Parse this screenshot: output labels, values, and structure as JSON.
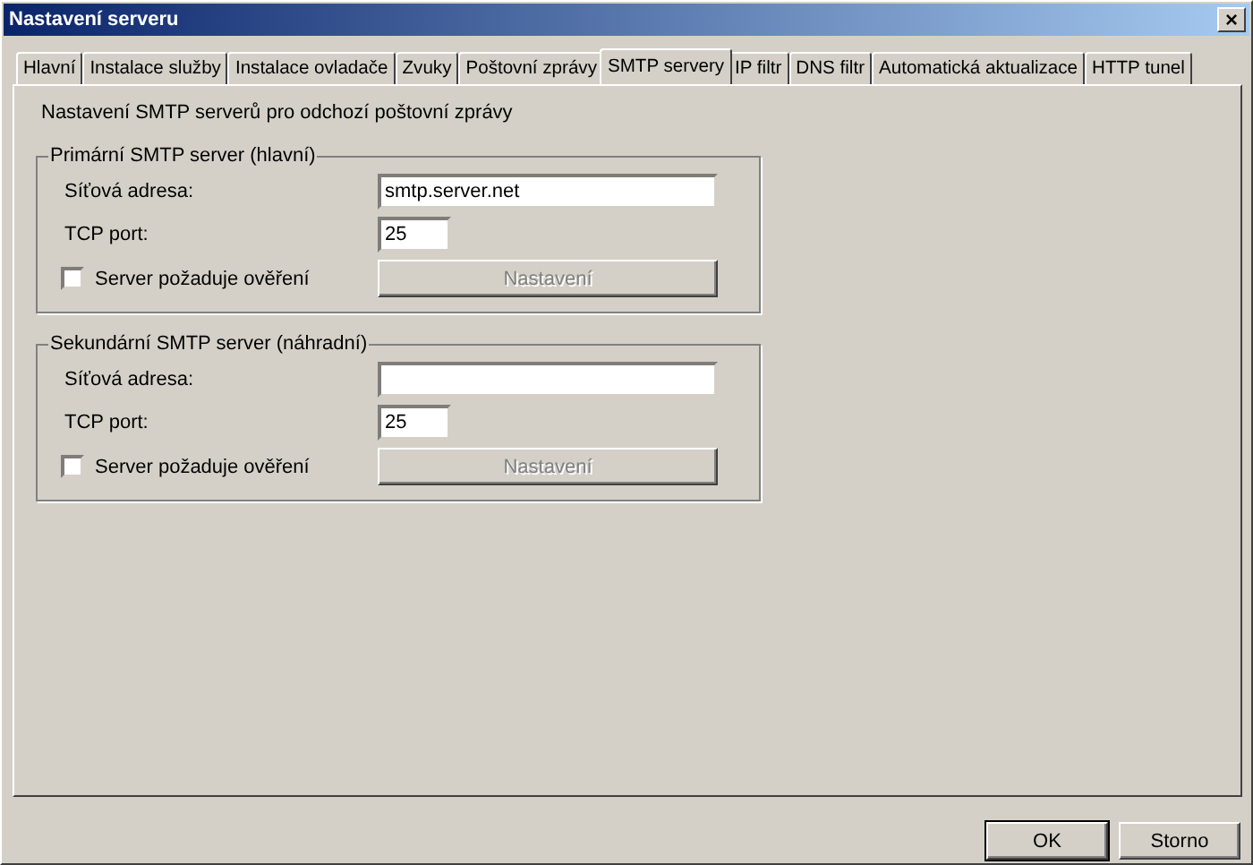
{
  "window": {
    "title": "Nastavení serveru",
    "close": "×"
  },
  "tabs": [
    {
      "label": "Hlavní",
      "selected": false
    },
    {
      "label": "Instalace služby",
      "selected": false
    },
    {
      "label": "Instalace ovladače",
      "selected": false
    },
    {
      "label": "Zvuky",
      "selected": false
    },
    {
      "label": "Poštovní zprávy",
      "selected": false
    },
    {
      "label": "SMTP servery",
      "selected": true
    },
    {
      "label": "IP filtr",
      "selected": false
    },
    {
      "label": "DNS filtr",
      "selected": false
    },
    {
      "label": "Automatická aktualizace",
      "selected": false
    },
    {
      "label": "HTTP tunel",
      "selected": false
    }
  ],
  "description": "Nastavení SMTP serverů pro odchozí poštovní zprávy",
  "groups": [
    {
      "title": "Primární SMTP server (hlavní)",
      "address_label": "Síťová adresa:",
      "address": "smtp.server.net",
      "port_label": "TCP port:",
      "port": "25",
      "auth_label": "Server požaduje ověření",
      "auth_checked": false,
      "settings_button": "Nastavení",
      "settings_disabled": true
    },
    {
      "title": "Sekundární SMTP server (náhradní)",
      "address_label": "Síťová adresa:",
      "port_label": "TCP port:",
      "port": "25",
      "auth_label": "Server požaduje ověření",
      "auth_checked": false,
      "settings_button": "Nastavení",
      "settings_disabled": true
    }
  ],
  "buttons": [
    "OK",
    "Storno"
  ]
}
